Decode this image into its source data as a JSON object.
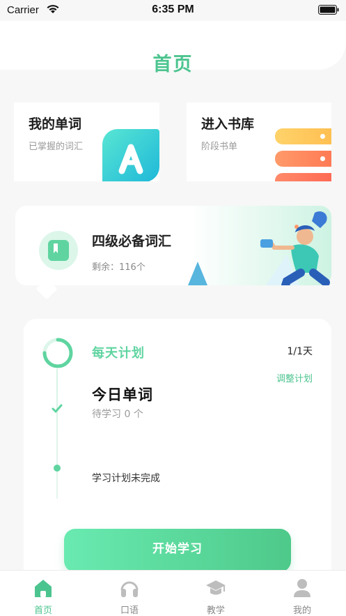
{
  "status_bar": {
    "carrier": "Carrier",
    "time": "6:35 PM"
  },
  "header": {
    "title": "首页"
  },
  "cards": {
    "my_words": {
      "title": "我的单词",
      "subtitle": "已掌握的词汇"
    },
    "library": {
      "title": "进入书库",
      "subtitle": "阶段书单"
    }
  },
  "vocab_book": {
    "title": "四级必备词汇",
    "remaining": "剩余：116个"
  },
  "plan": {
    "title": "每天计划",
    "days": "1/1天",
    "adjust_label": "调整计划",
    "today_title": "今日单词",
    "pending": "待学习 0 个",
    "status": "学习计划未完成",
    "progress": 0.75
  },
  "start_button": "开始学习",
  "tabs": [
    {
      "label": "首页",
      "icon": "home-icon",
      "active": true
    },
    {
      "label": "口语",
      "icon": "headphones-icon",
      "active": false
    },
    {
      "label": "教学",
      "icon": "graduation-cap-icon",
      "active": false
    },
    {
      "label": "我的",
      "icon": "user-icon",
      "active": false
    }
  ],
  "colors": {
    "accent": "#4cc48f",
    "accent_light": "#5fd4a0"
  }
}
